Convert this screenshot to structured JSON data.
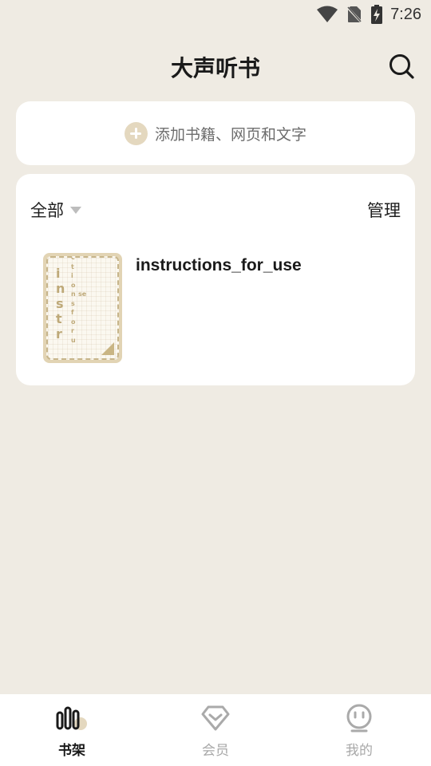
{
  "status_bar": {
    "time": "7:26",
    "icons": [
      "wifi-icon",
      "no-sim-icon",
      "battery-charging-icon"
    ]
  },
  "header": {
    "title": "大声听书",
    "search_icon": "search-icon"
  },
  "add_card": {
    "label": "添加书籍、网页和文字",
    "icon": "plus-circle-icon",
    "accent_color": "#e4d8bf"
  },
  "shelf": {
    "filter_label": "全部",
    "manage_label": "管理",
    "books": [
      {
        "title": "instructions_for_use",
        "cover_text": {
          "line1": "instr",
          "line2": "ctionsforu",
          "line3": "se"
        }
      }
    ]
  },
  "bottom_nav": {
    "items": [
      {
        "label": "书架",
        "icon": "bookshelf-icon",
        "active": true
      },
      {
        "label": "会员",
        "icon": "vip-diamond-icon",
        "active": false
      },
      {
        "label": "我的",
        "icon": "profile-face-icon",
        "active": false
      }
    ]
  },
  "colors": {
    "background": "#efebe3",
    "card": "#ffffff",
    "cover": "#e2d4b4",
    "nav_active": "#1a1a1a",
    "nav_inactive": "#a8a8a8"
  }
}
